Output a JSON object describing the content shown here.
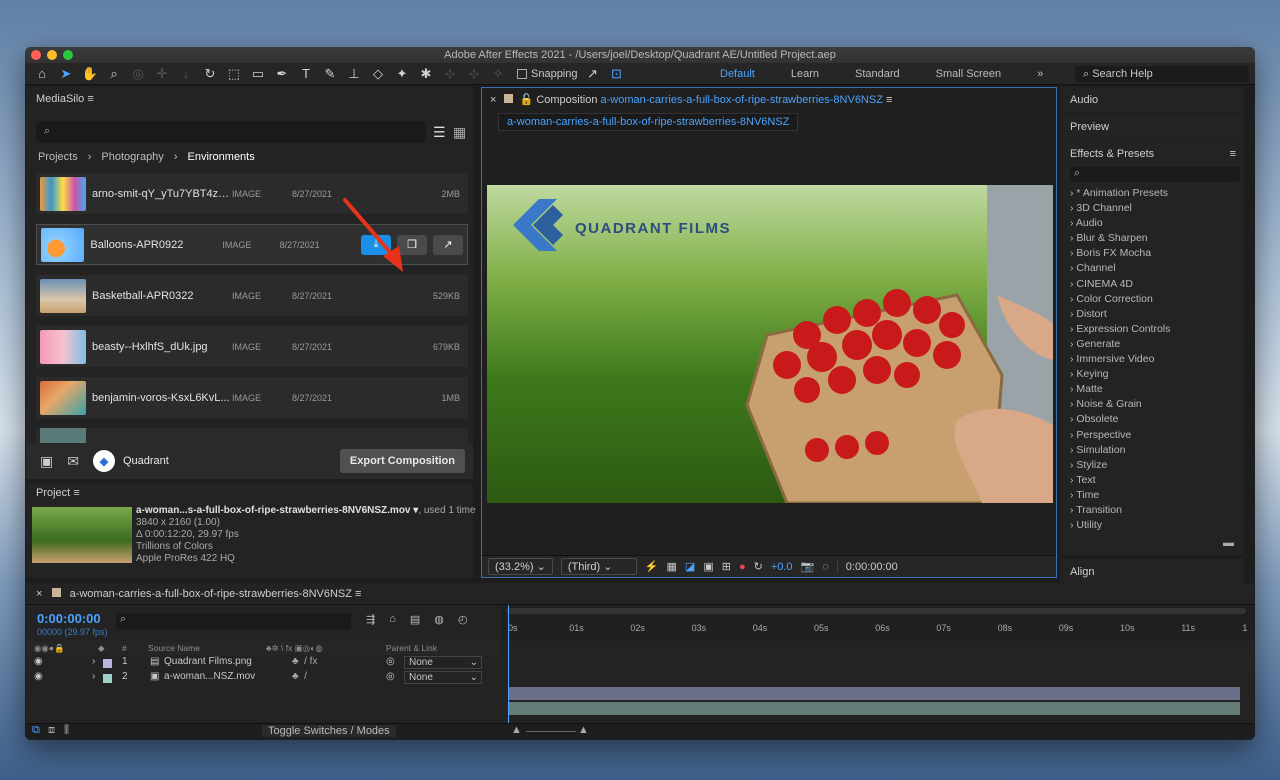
{
  "window": {
    "title": "Adobe After Effects 2021 - /Users/joel/Desktop/Quadrant AE/Untitled Project.aep"
  },
  "toolbar": {
    "snapping_label": "Snapping",
    "workspaces": [
      "Default",
      "Learn",
      "Standard",
      "Small Screen"
    ],
    "active_workspace": "Default",
    "search_help_placeholder": "Search Help"
  },
  "mediasilo": {
    "title": "MediaSilo",
    "breadcrumb": [
      "Projects",
      "Photography",
      "Environments"
    ],
    "files": [
      {
        "name": "arno-smit-qY_yTu7YBT4zz...",
        "type": "IMAGE",
        "date": "8/27/2021",
        "size": "2MB"
      },
      {
        "name": "Balloons-APR0922",
        "type": "IMAGE",
        "date": "8/27/2021",
        "size": ""
      },
      {
        "name": "Basketball-APR0322",
        "type": "IMAGE",
        "date": "8/27/2021",
        "size": "529KB"
      },
      {
        "name": "beasty--HxlhfS_dUk.jpg",
        "type": "IMAGE",
        "date": "8/27/2021",
        "size": "679KB"
      },
      {
        "name": "benjamin-voros-KsxL6KvL...",
        "type": "IMAGE",
        "date": "8/27/2021",
        "size": "1MB"
      }
    ],
    "footer_label": "Quadrant",
    "export_button": "Export Composition"
  },
  "project": {
    "title": "Project",
    "file_name": "a-woman...s-a-full-box-of-ripe-strawberries-8NV6NSZ.mov",
    "used": ", used 1 time",
    "details": [
      "3840 x 2160 (1.00)",
      "Δ 0:00:12:20, 29.97 fps",
      "Trillions of Colors",
      "Apple ProRes 422 HQ"
    ]
  },
  "composition": {
    "label": "Composition",
    "name": "a-woman-carries-a-full-box-of-ripe-strawberries-8NV6NSZ",
    "tab": "a-woman-carries-a-full-box-of-ripe-strawberries-8NV6NSZ",
    "logo_text": "QUADRANT FILMS",
    "zoom": "(33.2%)",
    "resolution": "(Third)",
    "exposure": "+0.0",
    "timecode": "0:00:00:00"
  },
  "right_panels": {
    "audio": "Audio",
    "preview": "Preview",
    "effects_title": "Effects & Presets",
    "effects": [
      "* Animation Presets",
      "3D Channel",
      "Audio",
      "Blur & Sharpen",
      "Boris FX Mocha",
      "Channel",
      "CINEMA 4D",
      "Color Correction",
      "Distort",
      "Expression Controls",
      "Generate",
      "Immersive Video",
      "Keying",
      "Matte",
      "Noise & Grain",
      "Obsolete",
      "Perspective",
      "Simulation",
      "Stylize",
      "Text",
      "Time",
      "Transition",
      "Utility"
    ],
    "align": "Align"
  },
  "timeline": {
    "tab": "a-woman-carries-a-full-box-of-ripe-strawberries-8NV6NSZ",
    "timecode": "0:00:00:00",
    "fps": "00000 (29.97 fps)",
    "columns": {
      "num": "#",
      "source": "Source Name",
      "parent": "Parent & Link"
    },
    "layers": [
      {
        "num": "1",
        "name": "Quadrant Films.png",
        "parent": "None"
      },
      {
        "num": "2",
        "name": "a-woman...NSZ.mov",
        "parent": "None"
      }
    ],
    "ticks": [
      "0s",
      "01s",
      "02s",
      "03s",
      "04s",
      "05s",
      "06s",
      "07s",
      "08s",
      "09s",
      "10s",
      "11s",
      "1"
    ],
    "toggle_label": "Toggle Switches / Modes"
  }
}
